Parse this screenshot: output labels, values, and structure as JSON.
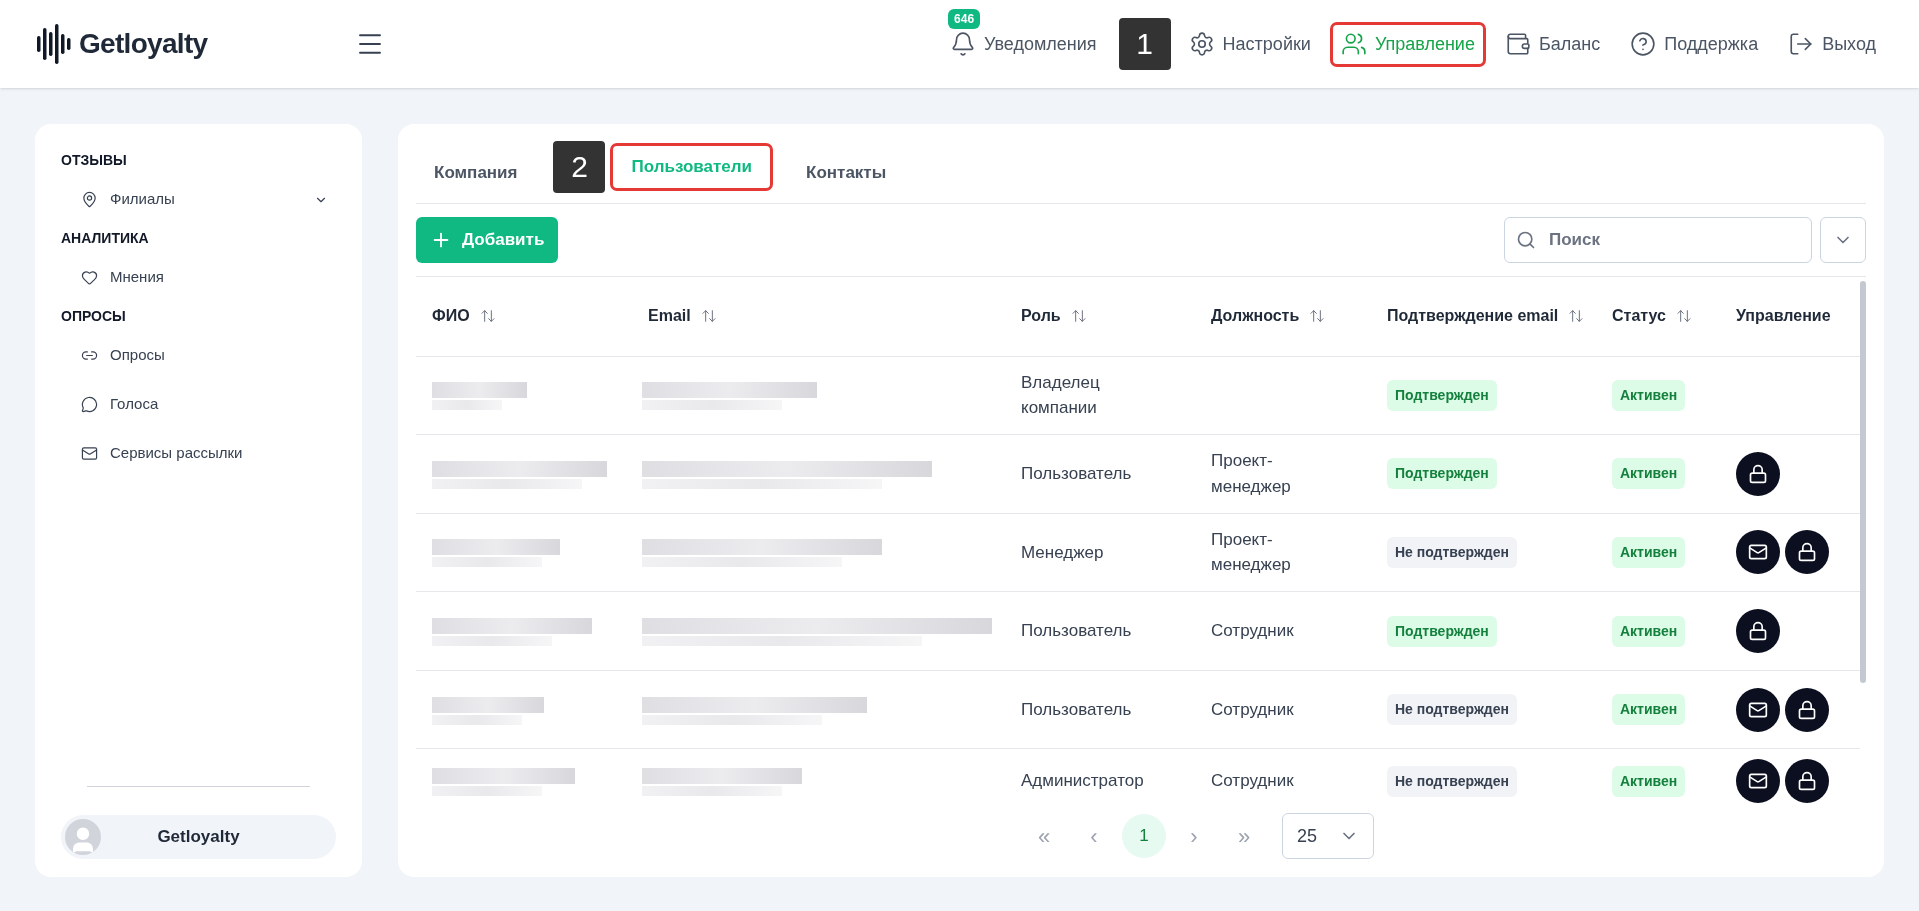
{
  "header": {
    "logo": "Getloyalty",
    "nav": [
      {
        "kind": "bell",
        "label": "Уведомления",
        "badge": "646",
        "selected": false
      },
      {
        "kind": "gear",
        "label": "Настройки",
        "selected": false,
        "callout": "1"
      },
      {
        "kind": "users",
        "label": "Управление",
        "selected": true
      },
      {
        "kind": "wallet",
        "label": "Баланс",
        "selected": false
      },
      {
        "kind": "help",
        "label": "Поддержка",
        "selected": false
      },
      {
        "kind": "logout",
        "label": "Выход",
        "selected": false
      }
    ]
  },
  "sidebar": {
    "sections": [
      {
        "title": "ОТЗЫВЫ",
        "items": [
          {
            "kind": "pin",
            "label": "Филиалы",
            "expandable": true
          }
        ]
      },
      {
        "title": "АНАЛИТИКА",
        "items": [
          {
            "kind": "heart",
            "label": "Мнения",
            "expandable": false
          }
        ]
      },
      {
        "title": "ОПРОСЫ",
        "items": [
          {
            "kind": "link",
            "label": "Опросы",
            "expandable": false
          },
          {
            "kind": "chat",
            "label": "Голоса",
            "expandable": false
          },
          {
            "kind": "mail",
            "label": "Сервисы рассылки",
            "expandable": false
          }
        ]
      }
    ],
    "account": "Getloyalty"
  },
  "tabs": [
    {
      "label": "Компания",
      "selected": false
    },
    {
      "label": "Пользователи",
      "selected": true,
      "callout": "2"
    },
    {
      "label": "Контакты",
      "selected": false
    }
  ],
  "add_button": "Добавить",
  "search": {
    "placeholder": "Поиск"
  },
  "table": {
    "columns": [
      {
        "label": "ФИО",
        "sortable": true
      },
      {
        "label": "Email",
        "sortable": true
      },
      {
        "label": "Роль",
        "sortable": true
      },
      {
        "label": "Должность",
        "sortable": true
      },
      {
        "label": "Подтверждение email",
        "sortable": true
      },
      {
        "label": "Статус",
        "sortable": true
      },
      {
        "label": "Управление",
        "sortable": false
      }
    ],
    "rows": [
      {
        "role": "Владелец компании",
        "position": "",
        "email_status": {
          "label": "Подтвержден",
          "confirmed": true
        },
        "status": "Активен",
        "actions": []
      },
      {
        "role": "Пользователь",
        "position": "Проект-менеджер",
        "email_status": {
          "label": "Подтвержден",
          "confirmed": true
        },
        "status": "Активен",
        "actions": [
          {
            "kind": "lock"
          }
        ]
      },
      {
        "role": "Менеджер",
        "position": "Проект-менеджер",
        "email_status": {
          "label": "Не подтвержден",
          "confirmed": false
        },
        "status": "Активен",
        "actions": [
          {
            "kind": "mail"
          },
          {
            "kind": "lock"
          }
        ]
      },
      {
        "role": "Пользователь",
        "position": "Сотрудник",
        "email_status": {
          "label": "Подтвержден",
          "confirmed": true
        },
        "status": "Активен",
        "actions": [
          {
            "kind": "lock"
          }
        ]
      },
      {
        "role": "Пользователь",
        "position": "Сотрудник",
        "email_status": {
          "label": "Не подтвержден",
          "confirmed": false
        },
        "status": "Активен",
        "actions": [
          {
            "kind": "mail"
          },
          {
            "kind": "lock"
          }
        ]
      },
      {
        "role": "Администратор",
        "position": "Сотрудник",
        "email_status": {
          "label": "Не подтвержден",
          "confirmed": false
        },
        "status": "Активен",
        "actions": [
          {
            "kind": "mail"
          },
          {
            "kind": "lock"
          }
        ]
      }
    ]
  },
  "pagination": {
    "first": "«",
    "prev": "‹",
    "pages": [
      {
        "label": "1",
        "selected": true
      }
    ],
    "next": "›",
    "last": "»",
    "page_size": "25"
  }
}
